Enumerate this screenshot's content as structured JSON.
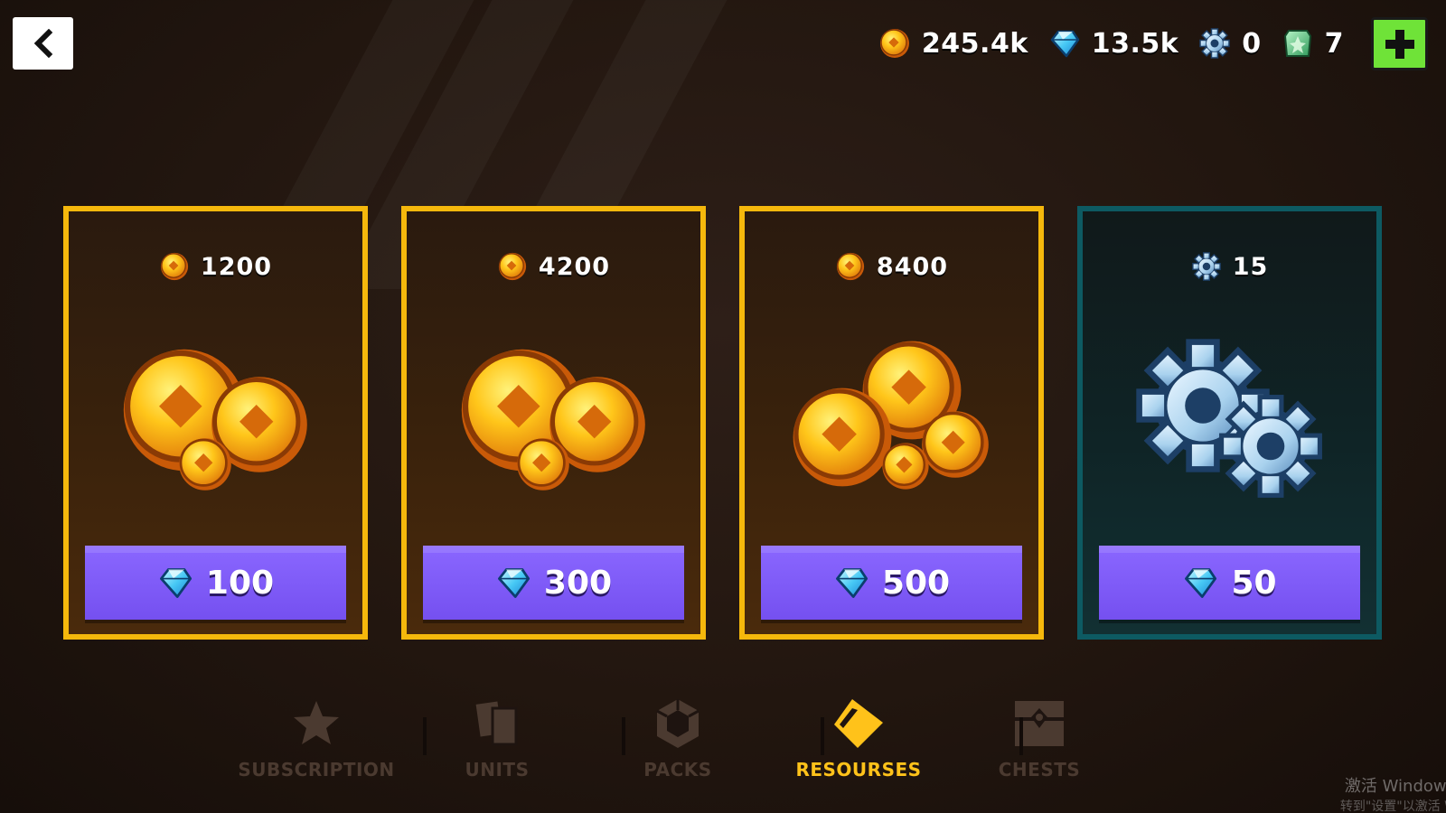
{
  "header": {
    "back_icon": "chevron-left-icon",
    "currencies": [
      {
        "icon": "coin-icon",
        "value": "245.4k"
      },
      {
        "icon": "gem-icon",
        "value": "13.5k"
      },
      {
        "icon": "gear-icon",
        "value": "0"
      },
      {
        "icon": "emerald-icon",
        "value": "7"
      }
    ],
    "add_icon": "plus-icon"
  },
  "offers": [
    {
      "currency_icon": "coin-icon",
      "amount": "1200",
      "art": "coin-pile-small",
      "price_icon": "gem-icon",
      "price": "100",
      "border": "#f5b80c"
    },
    {
      "currency_icon": "coin-icon",
      "amount": "4200",
      "art": "coin-pile-medium",
      "price_icon": "gem-icon",
      "price": "300",
      "border": "#f5b80c"
    },
    {
      "currency_icon": "coin-icon",
      "amount": "8400",
      "art": "coin-pile-large",
      "price_icon": "gem-icon",
      "price": "500",
      "border": "#f5b80c"
    },
    {
      "currency_icon": "gear-icon",
      "amount": "15",
      "art": "gears",
      "price_icon": "gem-icon",
      "price": "50",
      "border": "#0d5a62"
    }
  ],
  "nav": {
    "tabs": [
      {
        "label": "SUBSCRIPTION",
        "icon": "star-icon",
        "active": false
      },
      {
        "label": "UNITS",
        "icon": "cards-icon",
        "active": false
      },
      {
        "label": "PACKS",
        "icon": "hexagon-icon",
        "active": false
      },
      {
        "label": "RESOURSES",
        "icon": "resource-diamond-icon",
        "active": true
      },
      {
        "label": "CHESTS",
        "icon": "chest-icon",
        "active": false
      }
    ]
  },
  "watermark": {
    "line1": "激活 Windows",
    "line2": "转到\"设置\"以激活 W"
  },
  "colors": {
    "gold": "#f5b80c",
    "purple_button": "#7550f0",
    "green_plus": "#6fe338",
    "active_tab": "#ffc21a"
  }
}
